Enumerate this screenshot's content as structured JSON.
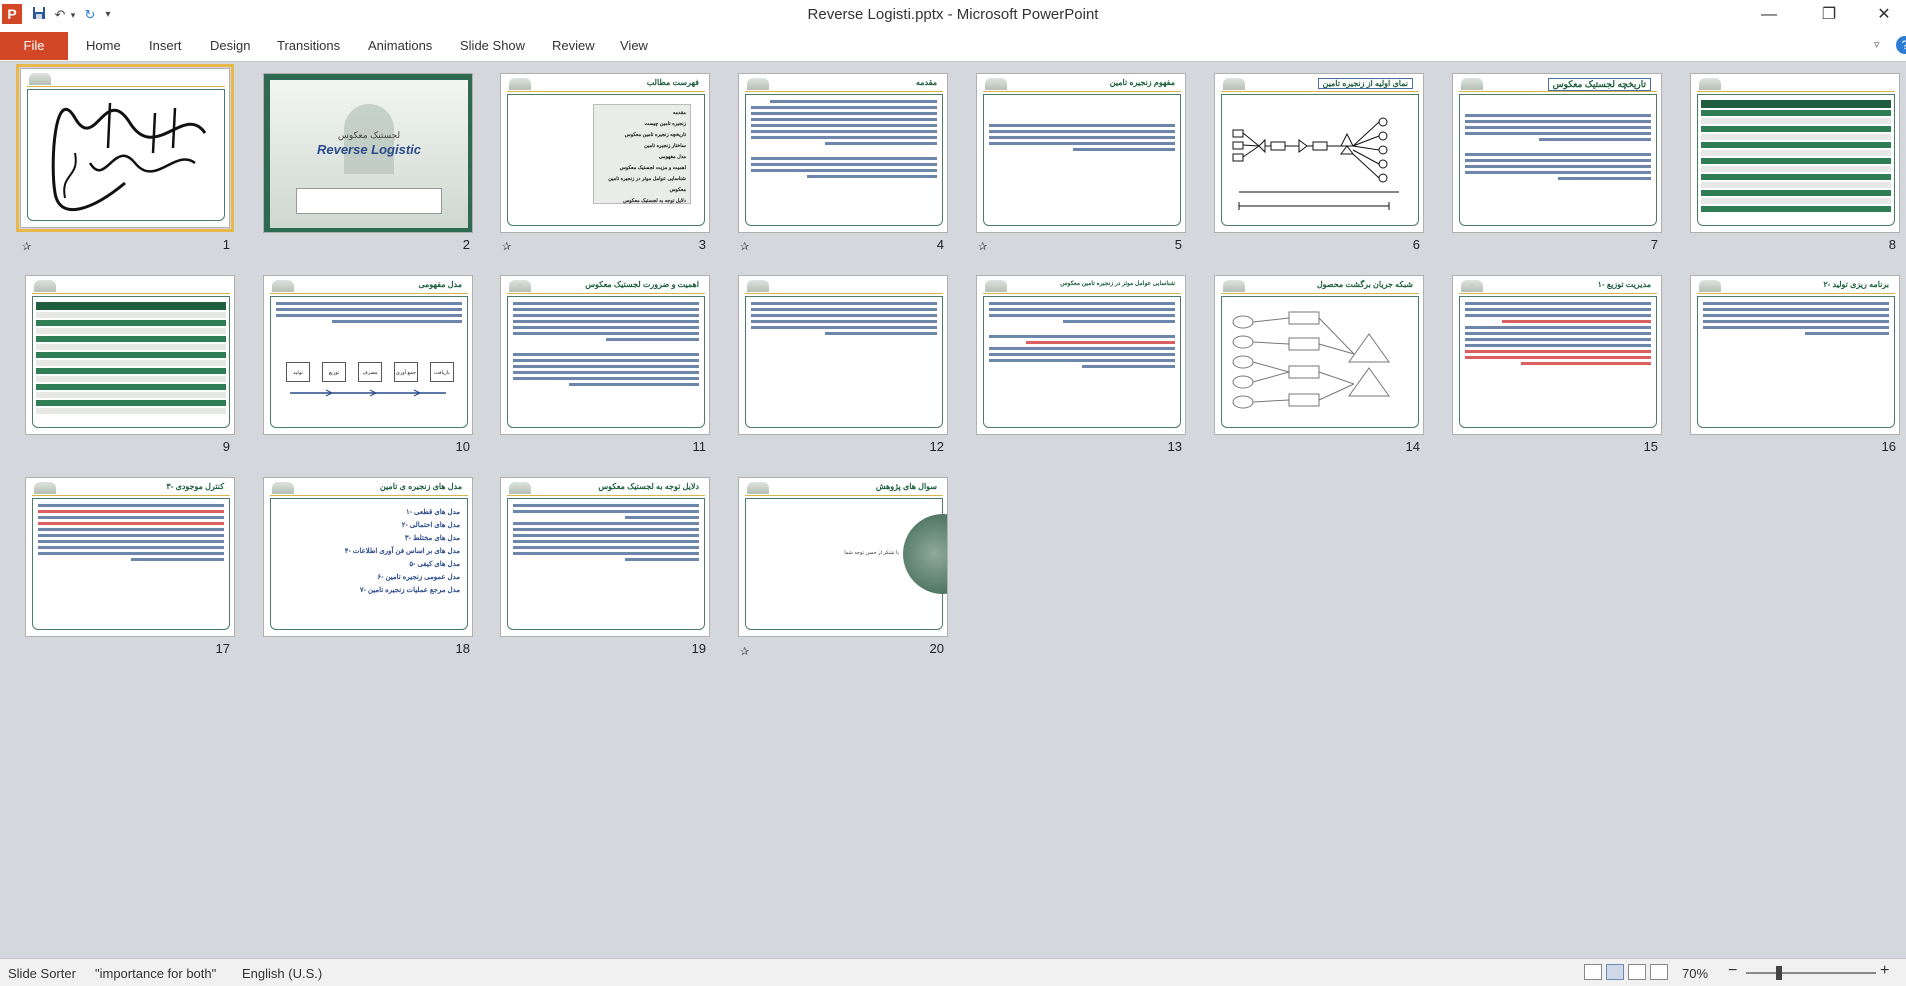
{
  "window": {
    "title": "Reverse Logisti.pptx  -  Microsoft PowerPoint",
    "app_logo": "P",
    "qat": {
      "save": "save-icon",
      "undo": "↶",
      "redo": "↻",
      "customize": "▾"
    },
    "controls": {
      "minimize": "—",
      "restore": "❐",
      "close": "✕"
    }
  },
  "ribbon": {
    "file": "File",
    "tabs": [
      "Home",
      "Insert",
      "Design",
      "Transitions",
      "Animations",
      "Slide Show",
      "Review",
      "View"
    ],
    "collapse": "▿",
    "help": "?"
  },
  "slides": [
    {
      "n": "1",
      "title": "",
      "kind": "calligraphy",
      "has_anim": true,
      "selected": true
    },
    {
      "n": "2",
      "title": "لجستیک معکوس",
      "subtitle": "Reverse Logistic",
      "kind": "cover",
      "has_anim": false
    },
    {
      "n": "3",
      "title": "فهرست مطالب",
      "kind": "toc",
      "has_anim": true,
      "items": [
        "مقدمه",
        "زنجیره تامین چیست",
        "تاریخچه زنجیره تامین معکوس",
        "ساختار زنجیره تامین",
        "مدل مفهومی",
        "اهمیت و مزیت لجستیک معکوس",
        "شناسایی عوامل موثر در زنجیره تامین معکوس",
        "دلایل توجه به لجستیک معکوس"
      ]
    },
    {
      "n": "4",
      "title": "مقدمه",
      "kind": "text",
      "has_anim": true
    },
    {
      "n": "5",
      "title": "مفهوم زنجیره تامین",
      "kind": "text",
      "has_anim": true
    },
    {
      "n": "6",
      "title": "نمای اولیه از زنجیره تامین",
      "kind": "diagram",
      "has_anim": false
    },
    {
      "n": "7",
      "title": "تاریخچه لجستیک معکوس",
      "kind": "text",
      "has_anim": false
    },
    {
      "n": "8",
      "title": "",
      "kind": "table",
      "has_anim": false
    },
    {
      "n": "9",
      "title": "",
      "kind": "table",
      "has_anim": false
    },
    {
      "n": "10",
      "title": "مدل مفهومی",
      "kind": "flow",
      "has_anim": false,
      "boxes": [
        "تولید",
        "توزیع",
        "مصرف",
        "جمع آوری",
        "بازیافت"
      ]
    },
    {
      "n": "11",
      "title": "اهمیت و ضرورت لجستیک معکوس",
      "kind": "text",
      "has_anim": false
    },
    {
      "n": "12",
      "title": "",
      "kind": "text",
      "has_anim": false
    },
    {
      "n": "13",
      "title": "شناسایی عوامل موثر در زنجیره تامین معکوس",
      "kind": "text",
      "has_anim": false
    },
    {
      "n": "14",
      "title": "شبکه جریان برگشت محصول",
      "kind": "network",
      "has_anim": false
    },
    {
      "n": "15",
      "title": "۱- مدیریت توزیع",
      "kind": "text-red",
      "has_anim": false
    },
    {
      "n": "16",
      "title": "۲- برنامه ریزی تولید",
      "kind": "text",
      "has_anim": false
    },
    {
      "n": "17",
      "title": "۳- کنترل موجودی",
      "kind": "text-red",
      "has_anim": false
    },
    {
      "n": "18",
      "title": "مدل های زنجیره ی تامین",
      "kind": "list",
      "has_anim": false,
      "items": [
        "۱- مدل های قطعی",
        "۲- مدل های احتمالی",
        "۳- مدل های مختلط",
        "۴- مدل های بر اساس فن آوری اطلاعات",
        "۵- مدل های کیفی",
        "۶- مدل عمومی زنجیره تامین",
        "۷- مدل مرجع عملیات زنجیره تامین"
      ]
    },
    {
      "n": "19",
      "title": "دلایل توجه به لجستیک معکوس",
      "kind": "text",
      "has_anim": false
    },
    {
      "n": "20",
      "title": "سوال های پژوهش",
      "kind": "end",
      "has_anim": true,
      "caption": "با تشکر از حسن توجه شما"
    }
  ],
  "status": {
    "view": "Slide Sorter",
    "theme": "\"importance for both\"",
    "language": "English (U.S.)",
    "zoom": "70%",
    "zoom_minus": "−",
    "zoom_plus": "+"
  }
}
